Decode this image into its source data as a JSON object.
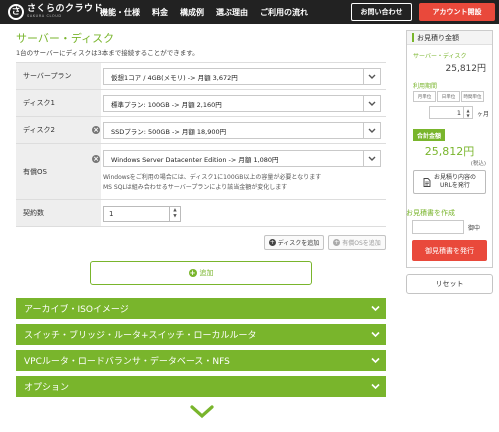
{
  "header": {
    "logo": {
      "mark": "さ",
      "name": "さくらのクラウド",
      "tagline": "SAKURA CLOUD"
    },
    "nav": [
      "機能・仕様",
      "料金",
      "構成例",
      "選ぶ理由",
      "ご利用の流れ"
    ],
    "contact_label": "お問い合わせ",
    "signup_label": "アカウント開設"
  },
  "page": {
    "title": "サーバー・ディスク",
    "subtitle": "1台のサーバーにディスクは3本まで接続することができます。"
  },
  "form": {
    "server_plan": {
      "label": "サーバープラン",
      "value": "仮想1コア / 4GB(メモリ) -> 月額 3,672円"
    },
    "disk1": {
      "label": "ディスク1",
      "value": "標準プラン: 100GB -> 月額 2,160円"
    },
    "disk2": {
      "label": "ディスク2",
      "value": "SSDプラン: 500GB -> 月額 18,900円"
    },
    "os": {
      "label": "有償OS",
      "value": "Windows Server Datacenter Edition -> 月額 1,080円",
      "note_line1": "Windowsをご利用の場合には、ディスク1に100GB以上の容量が必要となります",
      "note_line2": "MS SQLは組み合わせるサーバープランにより該当金額が変化します"
    },
    "quantity": {
      "label": "契約数",
      "value": "1"
    },
    "add_disk_label": "ディスクを追加",
    "add_os_label": "有償OSを追加",
    "add_label": "追加"
  },
  "accordions": [
    "アーカイブ・ISOイメージ",
    "スイッチ・ブリッジ・ルータ+スイッチ・ローカルルータ",
    "VPCルータ・ロードバランサ・データベース・NFS",
    "オプション"
  ],
  "estimate": {
    "title": "お見積り金額",
    "server_disk_label": "サーバー・ディスク",
    "server_disk_price": "25,812円",
    "period_label": "利用期間",
    "period_options": [
      "月単位",
      "日単位",
      "時間単位"
    ],
    "months_value": "1",
    "months_unit": "ヶ月",
    "total_label": "合計金額",
    "total_price": "25,812円",
    "tax_note": "(税込)",
    "url_button_line1": "お見積り内容の",
    "url_button_line2": "URLを発行",
    "doc_label": "お見積書を作成",
    "doc_unit": "御中",
    "issue_label": "御見積書を発行",
    "reset_label": "リセット"
  },
  "colors": {
    "accent": "#79b52c",
    "danger": "#e9493b",
    "header_bg": "#222222"
  }
}
